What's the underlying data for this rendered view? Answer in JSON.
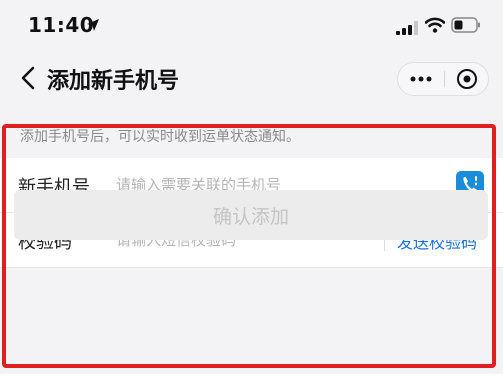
{
  "status_bar": {
    "time": "11:40",
    "icons": [
      "location-arrow-icon",
      "signal-icon",
      "wifi-icon",
      "battery-icon"
    ]
  },
  "nav": {
    "title": "添加新手机号",
    "icons": [
      "back-chevron-icon",
      "more-dots-icon",
      "close-circle-icon"
    ]
  },
  "form": {
    "notice": "添加手机号后，可以实时收到运单状态通知。",
    "phone": {
      "label": "新手机号",
      "placeholder": "请输入需要关联的手机号",
      "value": "",
      "icon": "contacts-phone-icon"
    },
    "code": {
      "label": "校验码",
      "placeholder": "请输入短信校验码",
      "value": "",
      "send_label": "发送校验码"
    },
    "confirm_label": "确认添加"
  },
  "colors": {
    "accent": "#1a73d9",
    "contact_icon_bg": "#1a8cd8",
    "highlight": "#e02020",
    "disabled_text": "#c4c4c4"
  }
}
